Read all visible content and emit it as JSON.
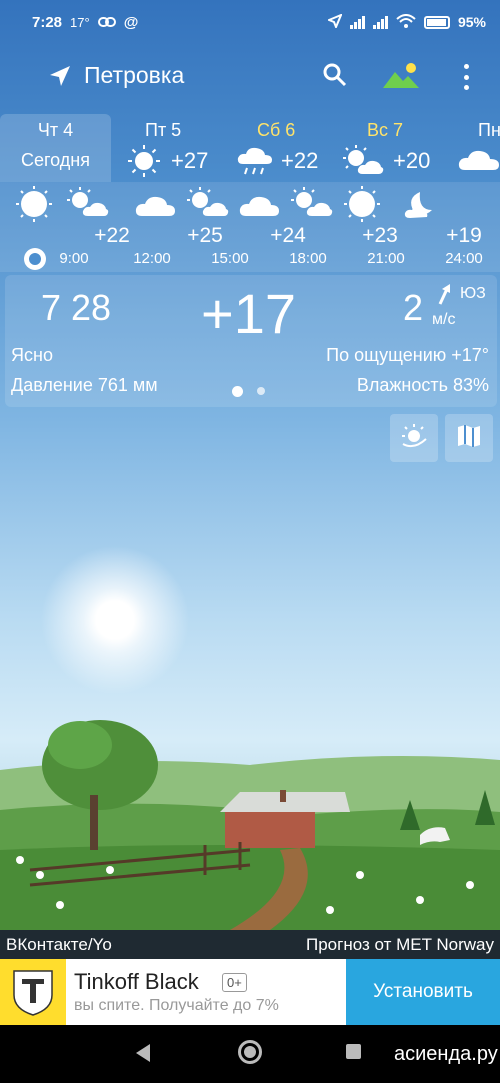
{
  "status_bar": {
    "time": "7:28",
    "notif": "17°",
    "battery": "95%"
  },
  "app_bar": {
    "city": "Петровка"
  },
  "days": [
    {
      "name": "Чт 4",
      "sub": "Сегодня",
      "selected": true
    },
    {
      "name": "Пт 5",
      "temp": "+27",
      "icon": "sunny-icon"
    },
    {
      "name": "Сб 6",
      "temp": "+22",
      "icon": "rain-icon"
    },
    {
      "name": "Вс 7",
      "temp": "+20",
      "icon": "partly-cloudy-icon"
    },
    {
      "name": "Пн",
      "icon": "cloud-icon"
    }
  ],
  "hourly": {
    "icons": [
      "sunny-icon",
      "partly-cloudy-icon",
      "cloud-icon",
      "partly-cloudy-icon",
      "cloud-icon",
      "partly-cloudy-icon",
      "sunny-icon",
      "moon-cloud-icon"
    ],
    "temps": [
      "+22",
      "+25",
      "+24",
      "+23",
      "+19"
    ],
    "times": [
      "9:00",
      "12:00",
      "15:00",
      "18:00",
      "21:00",
      "24:00"
    ]
  },
  "current": {
    "time": "7 28",
    "temp": "+17",
    "wind_speed": "2",
    "wind_dir": "ЮЗ",
    "wind_unit": "м/с",
    "condition": "Ясно",
    "feels_like": "По ощущению +17°",
    "pressure": "Давление 761 мм",
    "humidity": "Влажность 83%"
  },
  "credits": {
    "left": "ВКонтакте/Yo",
    "right": "Прогноз от MET Norway"
  },
  "ad": {
    "title": "Tinkoff Black",
    "age": "0+",
    "subtitle": "вы спите. Получайте до 7%",
    "button": "Установить"
  },
  "watermark": "асиенда.ру",
  "colors": {
    "sky_top": "#3473bd",
    "accent_yellow": "#ffe36a",
    "ad_button": "#29a6df",
    "ad_logo": "#ffdd2d"
  }
}
